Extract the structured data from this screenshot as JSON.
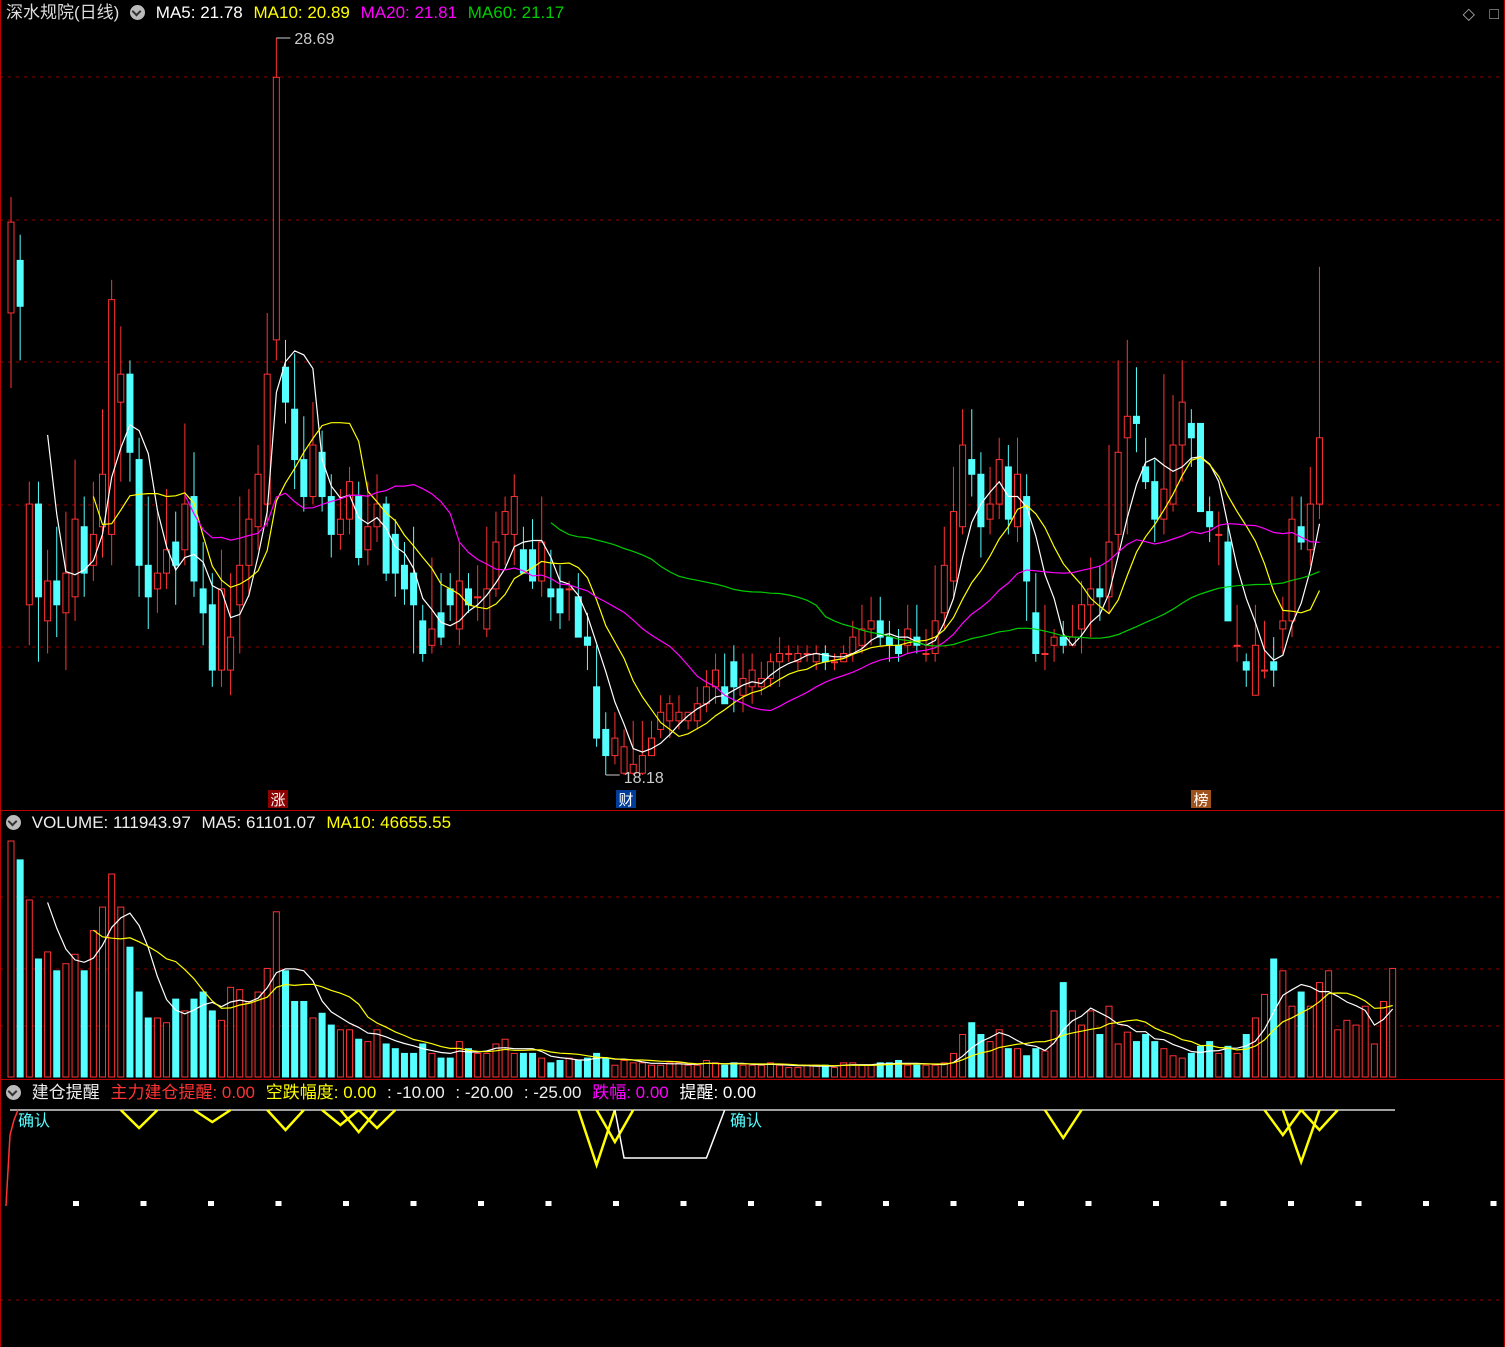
{
  "header": {
    "title": "深水规院(日线)",
    "ma5": "MA5: 21.78",
    "ma10": "MA10: 20.89",
    "ma20": "MA20: 21.81",
    "ma60": "MA60: 21.17"
  },
  "top_right_icons": [
    "diamond-icon",
    "square-icon"
  ],
  "volume_header": {
    "volume": "VOLUME: 111943.97",
    "ma5": "MA5: 61101.07",
    "ma10": "MA10: 46655.55"
  },
  "indicator_header": {
    "name": "建仓提醒",
    "main": "主力建仓提醒: 0.00",
    "drop": "空跌幅度: 0.00",
    "l1": ": -10.00",
    "l2": ": -20.00",
    "l3": ": -25.00",
    "fall": "跌幅: 0.00",
    "remind": "提醒: 0.00"
  },
  "indicator_labels": [
    "确认",
    "确认"
  ],
  "price_annotations": {
    "high": "28.69",
    "low": "18.18"
  },
  "event_markers": [
    "涨",
    "财",
    "榜"
  ],
  "colors": {
    "up": "#ff3232",
    "down": "#54ffff",
    "ma5": "#ffffff",
    "ma10": "#ffff00",
    "ma20": "#ff00ff",
    "ma60": "#00cc00",
    "grid": "#8a0000",
    "border": "#b00000"
  },
  "chart_data": {
    "type": "candlestick",
    "scale": "log",
    "ylim": [
      18.18,
      28.69
    ],
    "candles": [
      [
        24.2,
        25.6,
        23.1,
        26.0
      ],
      [
        25.0,
        24.3,
        23.5,
        25.4
      ],
      [
        20.2,
        21.5,
        19.7,
        21.8
      ],
      [
        21.5,
        20.3,
        19.5,
        21.8
      ],
      [
        20.0,
        20.5,
        19.6,
        20.9
      ],
      [
        20.5,
        20.2,
        19.8,
        21.2
      ],
      [
        20.1,
        20.6,
        19.4,
        21.4
      ],
      [
        20.3,
        21.3,
        20.0,
        22.1
      ],
      [
        21.2,
        20.6,
        20.3,
        21.6
      ],
      [
        20.7,
        21.1,
        20.5,
        21.8
      ],
      [
        21.2,
        21.9,
        20.8,
        22.8
      ],
      [
        21.1,
        24.4,
        20.7,
        24.7
      ],
      [
        22.9,
        23.3,
        21.8,
        24.0
      ],
      [
        23.3,
        22.2,
        21.8,
        23.5
      ],
      [
        22.1,
        20.7,
        20.3,
        22.4
      ],
      [
        20.7,
        20.3,
        19.9,
        21.6
      ],
      [
        20.4,
        20.6,
        20.1,
        21.4
      ],
      [
        20.6,
        20.9,
        20.4,
        21.7
      ],
      [
        21.0,
        20.7,
        20.2,
        21.4
      ],
      [
        20.9,
        21.5,
        20.7,
        22.6
      ],
      [
        21.6,
        20.5,
        20.3,
        22.2
      ],
      [
        20.4,
        20.1,
        19.7,
        21.0
      ],
      [
        20.2,
        19.4,
        19.2,
        20.6
      ],
      [
        19.4,
        20.4,
        19.2,
        20.9
      ],
      [
        19.4,
        19.8,
        19.1,
        20.6
      ],
      [
        20.2,
        20.7,
        19.6,
        21.6
      ],
      [
        20.7,
        21.3,
        20.3,
        21.7
      ],
      [
        21.2,
        21.9,
        20.9,
        22.3
      ],
      [
        21.5,
        23.3,
        21.2,
        24.2
      ],
      [
        23.8,
        28.0,
        23.5,
        28.69
      ],
      [
        23.4,
        22.9,
        22.6,
        23.8
      ],
      [
        22.8,
        22.1,
        21.7,
        23.6
      ],
      [
        22.1,
        21.6,
        21.4,
        22.7
      ],
      [
        21.6,
        22.3,
        21.5,
        22.9
      ],
      [
        22.2,
        21.6,
        21.4,
        22.5
      ],
      [
        21.6,
        21.1,
        20.8,
        21.9
      ],
      [
        21.1,
        21.3,
        20.9,
        21.7
      ],
      [
        21.3,
        21.8,
        21.1,
        22.0
      ],
      [
        21.6,
        20.8,
        20.7,
        21.8
      ],
      [
        20.9,
        21.2,
        20.7,
        21.8
      ],
      [
        21.2,
        21.5,
        21.0,
        21.9
      ],
      [
        21.5,
        20.6,
        20.5,
        21.6
      ],
      [
        21.1,
        20.6,
        20.3,
        21.3
      ],
      [
        20.7,
        20.4,
        20.2,
        21.0
      ],
      [
        20.6,
        20.2,
        19.6,
        21.2
      ],
      [
        20.0,
        19.6,
        19.5,
        20.2
      ],
      [
        19.7,
        19.9,
        19.6,
        20.8
      ],
      [
        20.1,
        19.8,
        19.7,
        20.6
      ],
      [
        20.4,
        20.2,
        20.0,
        20.6
      ],
      [
        19.9,
        20.5,
        19.7,
        21.0
      ],
      [
        20.4,
        20.2,
        20.1,
        20.6
      ],
      [
        20.3,
        20.3,
        20.0,
        20.7
      ],
      [
        19.9,
        20.4,
        19.8,
        21.2
      ],
      [
        20.4,
        21.0,
        20.3,
        21.4
      ],
      [
        21.1,
        21.4,
        20.7,
        21.6
      ],
      [
        21.1,
        21.6,
        20.7,
        21.9
      ],
      [
        20.9,
        20.6,
        20.6,
        21.2
      ],
      [
        20.9,
        20.5,
        20.4,
        21.3
      ],
      [
        20.5,
        21.0,
        20.3,
        21.6
      ],
      [
        20.4,
        20.3,
        20.0,
        20.9
      ],
      [
        20.4,
        20.1,
        19.9,
        20.7
      ],
      [
        20.4,
        20.4,
        20.0,
        20.5
      ],
      [
        20.3,
        19.8,
        19.8,
        20.6
      ],
      [
        19.8,
        19.7,
        19.4,
        20.1
      ],
      [
        19.2,
        18.6,
        18.5,
        19.7
      ],
      [
        18.7,
        18.4,
        18.18,
        18.9
      ],
      [
        18.4,
        18.6,
        18.3,
        18.9
      ],
      [
        18.2,
        18.5,
        18.18,
        18.7
      ],
      [
        18.2,
        18.3,
        18.18,
        18.8
      ],
      [
        18.2,
        18.4,
        18.18,
        18.8
      ],
      [
        18.4,
        18.6,
        18.4,
        18.8
      ],
      [
        18.7,
        18.9,
        18.6,
        19.1
      ],
      [
        18.8,
        19.0,
        18.6,
        19.1
      ],
      [
        18.8,
        18.9,
        18.7,
        19.1
      ],
      [
        18.8,
        18.9,
        18.7,
        18.9
      ],
      [
        18.8,
        19.0,
        18.7,
        19.2
      ],
      [
        19.0,
        19.2,
        18.9,
        19.4
      ],
      [
        19.2,
        19.4,
        19.0,
        19.6
      ],
      [
        19.2,
        19.0,
        19.0,
        19.6
      ],
      [
        19.5,
        19.2,
        18.9,
        19.7
      ],
      [
        19.1,
        19.3,
        18.9,
        19.6
      ],
      [
        19.2,
        19.4,
        19.0,
        19.6
      ],
      [
        19.2,
        19.3,
        19.1,
        19.5
      ],
      [
        19.3,
        19.5,
        19.2,
        19.6
      ],
      [
        19.5,
        19.6,
        19.2,
        19.8
      ],
      [
        19.6,
        19.6,
        19.5,
        19.7
      ],
      [
        19.5,
        19.6,
        19.4,
        19.7
      ],
      [
        19.6,
        19.6,
        19.5,
        19.7
      ],
      [
        19.5,
        19.6,
        19.4,
        19.7
      ],
      [
        19.6,
        19.5,
        19.4,
        19.7
      ],
      [
        19.5,
        19.5,
        19.4,
        19.6
      ],
      [
        19.5,
        19.6,
        19.5,
        19.7
      ],
      [
        19.6,
        19.8,
        19.5,
        20.0
      ],
      [
        19.7,
        19.9,
        19.6,
        20.2
      ],
      [
        19.9,
        20.0,
        19.7,
        20.3
      ],
      [
        20.0,
        19.8,
        19.7,
        20.3
      ],
      [
        19.8,
        19.7,
        19.5,
        20.0
      ],
      [
        19.7,
        19.6,
        19.5,
        19.9
      ],
      [
        19.7,
        19.9,
        19.6,
        20.2
      ],
      [
        19.8,
        19.7,
        19.6,
        20.2
      ],
      [
        19.6,
        19.6,
        19.5,
        19.9
      ],
      [
        19.6,
        20.0,
        19.5,
        20.7
      ],
      [
        20.1,
        20.7,
        19.9,
        21.2
      ],
      [
        20.5,
        21.4,
        20.3,
        22.0
      ],
      [
        21.2,
        22.3,
        21.1,
        22.8
      ],
      [
        22.1,
        21.9,
        21.6,
        22.8
      ],
      [
        21.9,
        21.2,
        20.8,
        22.2
      ],
      [
        21.3,
        21.5,
        21.1,
        22.0
      ],
      [
        21.5,
        22.1,
        21.3,
        22.4
      ],
      [
        22.0,
        21.3,
        21.1,
        22.3
      ],
      [
        21.2,
        21.9,
        21.0,
        22.4
      ],
      [
        21.6,
        20.5,
        20.0,
        21.9
      ],
      [
        20.1,
        19.6,
        19.5,
        20.6
      ],
      [
        19.6,
        19.6,
        19.4,
        20.2
      ],
      [
        19.7,
        19.8,
        19.5,
        19.9
      ],
      [
        19.8,
        19.7,
        19.6,
        20.0
      ],
      [
        19.7,
        19.8,
        19.7,
        20.2
      ],
      [
        19.9,
        20.2,
        19.6,
        20.5
      ],
      [
        20.2,
        20.4,
        19.8,
        20.8
      ],
      [
        20.4,
        20.3,
        20.0,
        20.7
      ],
      [
        20.3,
        21.0,
        20.1,
        22.3
      ],
      [
        21.1,
        22.2,
        20.8,
        23.5
      ],
      [
        22.4,
        22.7,
        21.1,
        23.8
      ],
      [
        22.7,
        22.6,
        22.2,
        23.4
      ],
      [
        22.0,
        21.8,
        21.7,
        22.4
      ],
      [
        21.8,
        21.3,
        21.0,
        22.1
      ],
      [
        21.3,
        21.7,
        21.1,
        23.3
      ],
      [
        21.5,
        22.3,
        21.4,
        23.0
      ],
      [
        22.3,
        22.9,
        21.8,
        23.5
      ],
      [
        22.6,
        22.4,
        22.0,
        22.8
      ],
      [
        22.6,
        21.4,
        21.4,
        22.6
      ],
      [
        21.4,
        21.2,
        21.0,
        21.6
      ],
      [
        21.1,
        21.1,
        20.7,
        21.4
      ],
      [
        21.0,
        20.0,
        20.0,
        21.2
      ],
      [
        19.7,
        19.7,
        19.5,
        20.2
      ],
      [
        19.5,
        19.4,
        19.2,
        19.6
      ],
      [
        19.1,
        19.7,
        19.1,
        20.2
      ],
      [
        19.4,
        19.4,
        19.3,
        20.0
      ],
      [
        19.5,
        19.4,
        19.2,
        19.8
      ],
      [
        19.9,
        20.0,
        19.6,
        20.3
      ],
      [
        20.0,
        21.3,
        19.8,
        21.6
      ],
      [
        21.2,
        21.0,
        20.9,
        21.6
      ],
      [
        20.9,
        21.5,
        20.7,
        22.0
      ],
      [
        21.5,
        22.4,
        21.3,
        24.9
      ]
    ],
    "volume": {
      "bars": [
        [
          0,
          100
        ],
        [
          1,
          92
        ],
        [
          2,
          75
        ],
        [
          3,
          50
        ],
        [
          4,
          53
        ],
        [
          5,
          45
        ],
        [
          6,
          48
        ],
        [
          7,
          52
        ],
        [
          8,
          45
        ],
        [
          9,
          62
        ],
        [
          10,
          72
        ],
        [
          11,
          86
        ],
        [
          12,
          72
        ],
        [
          13,
          55
        ],
        [
          14,
          36
        ],
        [
          15,
          25
        ],
        [
          16,
          25
        ],
        [
          17,
          23
        ],
        [
          18,
          33
        ],
        [
          19,
          28
        ],
        [
          20,
          33
        ],
        [
          21,
          36
        ],
        [
          22,
          28
        ],
        [
          23,
          24
        ],
        [
          24,
          38
        ],
        [
          25,
          37
        ],
        [
          26,
          32
        ],
        [
          27,
          36
        ],
        [
          28,
          46
        ],
        [
          29,
          70
        ],
        [
          30,
          45
        ],
        [
          31,
          32
        ],
        [
          32,
          32
        ],
        [
          33,
          25
        ],
        [
          34,
          27
        ],
        [
          35,
          22
        ],
        [
          36,
          20
        ],
        [
          37,
          20
        ],
        [
          38,
          16
        ],
        [
          39,
          15
        ],
        [
          40,
          20
        ],
        [
          41,
          14
        ],
        [
          42,
          12
        ],
        [
          43,
          10
        ],
        [
          44,
          10
        ],
        [
          45,
          14
        ],
        [
          46,
          10
        ],
        [
          47,
          8
        ],
        [
          48,
          8
        ],
        [
          49,
          15
        ],
        [
          50,
          12
        ],
        [
          51,
          10
        ],
        [
          52,
          10
        ],
        [
          53,
          14
        ],
        [
          54,
          16
        ],
        [
          55,
          10
        ],
        [
          56,
          10
        ],
        [
          57,
          10
        ],
        [
          58,
          8
        ],
        [
          59,
          6
        ],
        [
          60,
          7
        ],
        [
          61,
          8
        ],
        [
          62,
          7
        ],
        [
          63,
          8
        ],
        [
          64,
          10
        ],
        [
          65,
          8
        ],
        [
          66,
          5
        ],
        [
          67,
          7
        ],
        [
          68,
          6
        ],
        [
          69,
          6
        ],
        [
          70,
          5
        ],
        [
          71,
          5
        ],
        [
          72,
          6
        ],
        [
          73,
          6
        ],
        [
          74,
          5
        ],
        [
          75,
          5
        ],
        [
          76,
          7
        ],
        [
          77,
          6
        ],
        [
          78,
          5
        ],
        [
          79,
          6
        ],
        [
          80,
          5
        ],
        [
          81,
          5
        ],
        [
          82,
          5
        ],
        [
          83,
          6
        ],
        [
          84,
          5
        ],
        [
          85,
          4
        ],
        [
          86,
          4
        ],
        [
          87,
          5
        ],
        [
          88,
          5
        ],
        [
          89,
          5
        ],
        [
          90,
          4
        ],
        [
          91,
          6
        ],
        [
          92,
          6
        ],
        [
          93,
          5
        ],
        [
          94,
          5
        ],
        [
          95,
          6
        ],
        [
          96,
          6
        ],
        [
          97,
          7
        ],
        [
          98,
          5
        ],
        [
          99,
          5
        ],
        [
          100,
          5
        ],
        [
          101,
          5
        ],
        [
          102,
          6
        ],
        [
          103,
          10
        ],
        [
          104,
          18
        ],
        [
          105,
          23
        ],
        [
          106,
          18
        ],
        [
          107,
          15
        ],
        [
          108,
          20
        ],
        [
          109,
          12
        ],
        [
          110,
          12
        ],
        [
          111,
          9
        ],
        [
          112,
          12
        ],
        [
          113,
          11
        ],
        [
          114,
          28
        ],
        [
          115,
          40
        ],
        [
          116,
          28
        ],
        [
          117,
          22
        ],
        [
          118,
          28
        ],
        [
          119,
          18
        ],
        [
          120,
          30
        ],
        [
          121,
          14
        ],
        [
          122,
          19
        ],
        [
          123,
          15
        ],
        [
          124,
          18
        ],
        [
          125,
          15
        ],
        [
          126,
          12
        ],
        [
          127,
          9
        ],
        [
          128,
          8
        ],
        [
          129,
          10
        ],
        [
          130,
          13
        ],
        [
          131,
          15
        ],
        [
          132,
          10
        ],
        [
          133,
          13
        ],
        [
          134,
          10
        ],
        [
          135,
          18
        ],
        [
          136,
          25
        ],
        [
          137,
          35
        ],
        [
          138,
          50
        ],
        [
          139,
          45
        ],
        [
          140,
          30
        ],
        [
          141,
          36
        ],
        [
          142,
          30
        ],
        [
          143,
          40
        ],
        [
          144,
          45
        ],
        [
          145,
          20
        ],
        [
          146,
          24
        ],
        [
          147,
          22
        ],
        [
          148,
          30
        ],
        [
          149,
          14
        ],
        [
          150,
          32
        ],
        [
          151,
          46
        ]
      ]
    }
  }
}
